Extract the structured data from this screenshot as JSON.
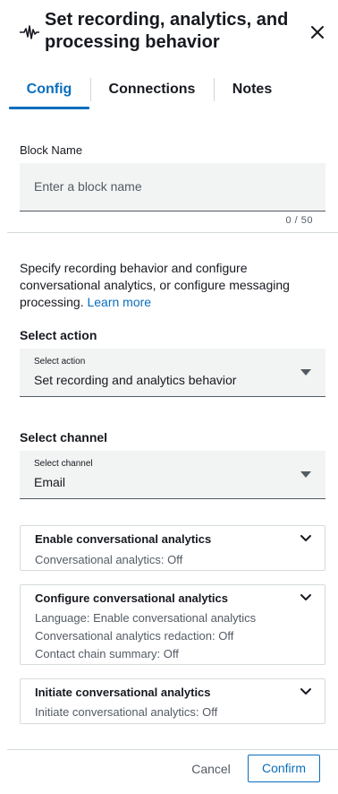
{
  "header": {
    "icon": "waveform-icon",
    "title": "Set recording, analytics, and processing behavior",
    "close_icon": "close-icon"
  },
  "tabs": [
    {
      "label": "Config",
      "active": true
    },
    {
      "label": "Connections",
      "active": false
    },
    {
      "label": "Notes",
      "active": false
    }
  ],
  "block_name": {
    "label": "Block Name",
    "placeholder": "Enter a block name",
    "value": "",
    "counter": "0 / 50"
  },
  "description": {
    "text": "Specify recording behavior and configure conversational analytics, or configure messaging processing.",
    "link": "Learn more"
  },
  "select_action": {
    "label": "Select action",
    "small_label": "Select action",
    "value": "Set recording and analytics behavior"
  },
  "select_channel": {
    "label": "Select channel",
    "small_label": "Select channel",
    "value": "Email"
  },
  "cards": [
    {
      "title": "Enable conversational analytics",
      "lines": [
        "Conversational analytics: Off"
      ]
    },
    {
      "title": "Configure conversational analytics",
      "lines": [
        "Language: Enable conversational analytics",
        "Conversational analytics redaction: Off",
        "Contact chain summary: Off"
      ]
    },
    {
      "title": "Initiate conversational analytics",
      "lines": [
        "Initiate conversational analytics: Off"
      ]
    }
  ],
  "footer": {
    "cancel_label": "Cancel",
    "confirm_label": "Confirm"
  },
  "colors": {
    "accent": "#0a6ebd",
    "text": "#16191f",
    "muted": "#545b64",
    "field_bg": "#f2f3f3",
    "border": "#d5dbdb"
  }
}
